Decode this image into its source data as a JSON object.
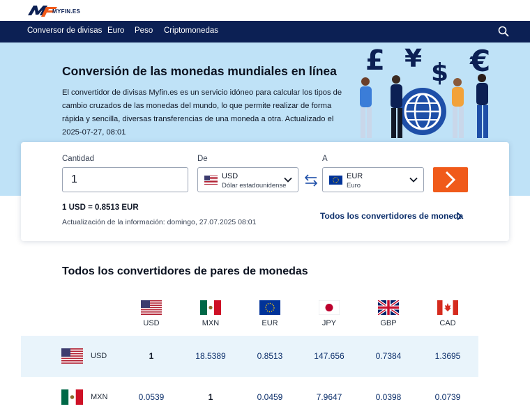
{
  "brand": {
    "logo_text": "MYFIN.ES",
    "logo_alt": "MyFin logo"
  },
  "nav": {
    "items": [
      "Conversor de divisas",
      "Euro",
      "Peso",
      "Criptomonedas"
    ]
  },
  "hero": {
    "title": "Conversión de las monedas mundiales en línea",
    "description": "El convertidor de divisas Myfin.es es un servicio idóneo para calcular los tipos de cambio cruzados de las monedas del mundo, lo que permite realizar de forma rápida y sencilla, diversas transferencias de una moneda a otra. Actualizado el 2025-07-27, 08:01"
  },
  "converter": {
    "amount_label": "Cantidad",
    "amount_value": "1",
    "from_label": "De",
    "from_code": "USD",
    "from_name": "Dólar estadounidense",
    "to_label": "A",
    "to_code": "EUR",
    "to_name": "Euro",
    "rate_text": "1 USD = 0.8513 EUR",
    "update_text": "Actualización de la información: domingo, 27.07.2025 08:01",
    "all_converters_link": "Todos los convertidores de moneda"
  },
  "pairs": {
    "title": "Todos los convertidores de pares de monedas",
    "columns": [
      "USD",
      "MXN",
      "EUR",
      "JPY",
      "GBP",
      "CAD"
    ],
    "rows": [
      {
        "code": "USD",
        "values": [
          "1",
          "18.5389",
          "0.8513",
          "147.656",
          "0.7384",
          "1.3695"
        ]
      },
      {
        "code": "MXN",
        "values": [
          "0.0539",
          "1",
          "0.0459",
          "7.9647",
          "0.0398",
          "0.0739"
        ]
      }
    ]
  },
  "colors": {
    "nav_bg": "#0c2054",
    "hero_bg": "#bfe2f7",
    "accent_orange": "#f05a1a",
    "link_blue": "#0c2f6b",
    "row_alt": "#e9f4fb"
  },
  "icons": {
    "search": "search-icon",
    "swap": "swap-arrows-icon",
    "go": "chevron-right-icon",
    "select_chevron": "chevron-down-icon"
  }
}
